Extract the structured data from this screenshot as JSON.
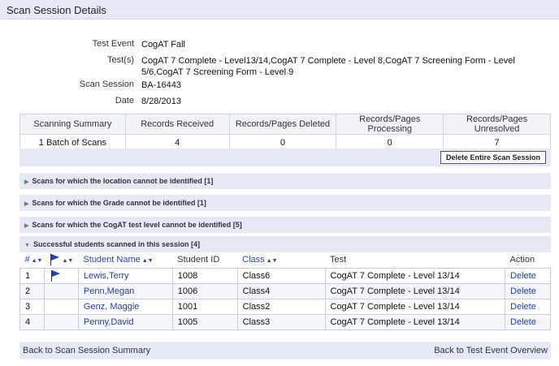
{
  "page_title": "Scan Session Details",
  "details": {
    "test_event_label": "Test Event",
    "test_event_value": "CogAT  Fall",
    "tests_label": "Test(s)",
    "tests_value": "CogAT 7 Complete - Level13/14,CogAT 7 Complete - Level 8,CogAT 7 Screening Form - Level 5/6,CogAT 7 Screening Form - Level 9",
    "scan_session_label": "Scan Session",
    "scan_session_value": "BA-16443",
    "date_label": "Date",
    "date_value": "8/28/2013"
  },
  "summary": {
    "headers": [
      "Scanning Summary",
      "Records Received",
      "Records/Pages Deleted",
      "Records/Pages Processing",
      "Records/Pages Unresolved"
    ],
    "row": [
      "1 Batch of Scans",
      "4",
      "0",
      "0",
      "7"
    ]
  },
  "delete_button_label": "Delete Entire Scan Session",
  "sections": [
    "Scans for which the location cannot be identified [1]",
    "Scans for which the Grade cannot be identified [1]",
    "Scans for which the CogAT test level cannot be identified [5]",
    "Successful students scanned in this session [4]"
  ],
  "students": {
    "headers": {
      "num": "#",
      "student_name": "Student Name",
      "student_id": "Student ID",
      "class": "Class",
      "test": "Test",
      "action": "Action"
    },
    "rows": [
      {
        "num": "1",
        "name": "Lewis,Terry",
        "id": "1008",
        "class": "Class6",
        "test": "CogAT 7 Complete - Level 13/14",
        "action": "Delete",
        "flagged": true
      },
      {
        "num": "2",
        "name": "Penn,Megan",
        "id": "1006",
        "class": "Class4",
        "test": "CogAT 7 Complete - Level 13/14",
        "action": "Delete",
        "flagged": false
      },
      {
        "num": "3",
        "name": "Genz, Maggie",
        "id": "1001",
        "class": "Class2",
        "test": "CogAT 7 Complete - Level 13/14",
        "action": "Delete",
        "flagged": false
      },
      {
        "num": "4",
        "name": "Penny,David",
        "id": "1005",
        "class": "Class3",
        "test": "CogAT 7 Complete - Level 13/14",
        "action": "Delete",
        "flagged": false
      }
    ]
  },
  "footer": {
    "back_summary": "Back to Scan Session Summary",
    "back_overview": "Back to Test Event Overview"
  },
  "colors": {
    "section_bg": "#e4e9f5",
    "link": "#1b3fb5",
    "flag": "#2441a8"
  }
}
